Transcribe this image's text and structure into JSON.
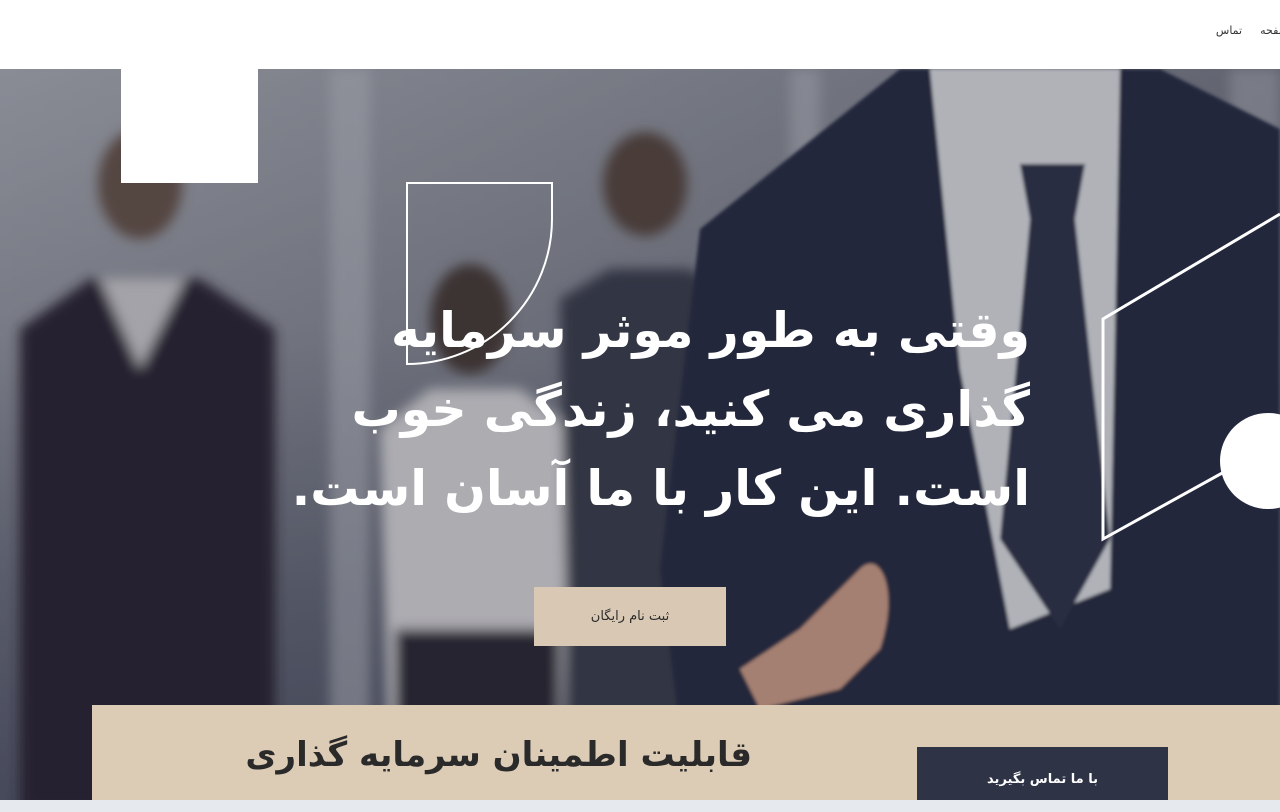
{
  "nav": {
    "items": [
      "صفحه",
      "تماس"
    ]
  },
  "hero": {
    "headline": "وقتی به طور موثر سرمایه گذاری می کنید، زندگی خوب است. این کار با ما آسان است.",
    "cta_label": "ثبت نام رایگان"
  },
  "band": {
    "title": "قابلیت اطمینان سرمایه گذاری",
    "contact_label": "با ما تماس بگیرید"
  },
  "colors": {
    "cta_bg": "#d9c9b4",
    "band_bg": "#dccbb5",
    "contact_bg": "#2e3346"
  }
}
